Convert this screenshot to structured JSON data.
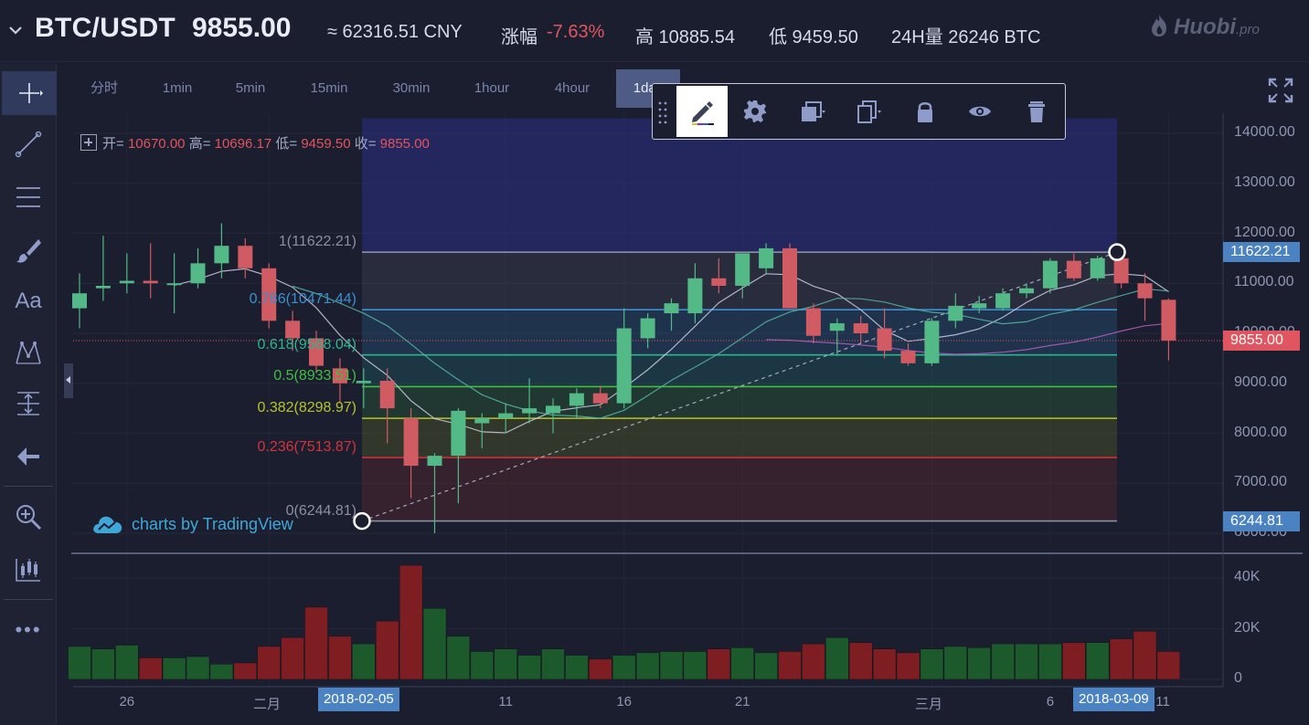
{
  "header": {
    "pair": "BTC/USDT",
    "price": "9855.00",
    "cny": "≈ 62316.51 CNY",
    "change_label": "涨幅",
    "change_value": "-7.63%",
    "high": "高 10885.54",
    "low": "低 9459.50",
    "volume24h": "24H量 26246 BTC",
    "logo": "Huobi",
    "logo_suffix": ".pro"
  },
  "left_toolbar": {
    "items": [
      "crosshair-icon",
      "trend-line-icon",
      "horizontal-lines-icon",
      "brush-icon",
      "text-icon",
      "pattern-icon",
      "measure-icon",
      "back-arrow-icon",
      "zoom-in-icon",
      "bar-chart-icon",
      "more-icon"
    ],
    "text_tool_label": "Aa",
    "more_label": "•••"
  },
  "intervals": [
    {
      "label": "分时"
    },
    {
      "label": "1min"
    },
    {
      "label": "5min"
    },
    {
      "label": "15min"
    },
    {
      "label": "30min"
    },
    {
      "label": "1hour"
    },
    {
      "label": "4hour"
    },
    {
      "label": "1day"
    }
  ],
  "active_interval": "1day",
  "floating_toolbar": [
    "pencil-icon",
    "gear-icon",
    "layer-icon",
    "copy-icon",
    "lock-icon",
    "eye-icon",
    "trash-icon"
  ],
  "legend": {
    "open_label": "开=",
    "open": "10670.00",
    "high_label": "高=",
    "high": "10696.17",
    "low_label": "低=",
    "low": "9459.50",
    "close_label": "收=",
    "close": "9855.00"
  },
  "watermark": "charts by TradingView",
  "fib_levels": [
    {
      "label": "1(11622.21)",
      "price": 11622.21,
      "color": "#8a8fa3"
    },
    {
      "label": "0.786(10471.44)",
      "price": 10471.44,
      "color": "#3a8fd0"
    },
    {
      "label": "0.618(9568.04)",
      "price": 9568.04,
      "color": "#2bb58f"
    },
    {
      "label": "0.5(8933.51)",
      "price": 8933.51,
      "color": "#3fbf3f"
    },
    {
      "label": "0.382(8298.97)",
      "price": 8298.97,
      "color": "#b5c42a"
    },
    {
      "label": "0.236(7513.87)",
      "price": 7513.87,
      "color": "#d1343c"
    },
    {
      "label": "0(6244.81)",
      "price": 6244.81,
      "color": "#8a8fa3"
    }
  ],
  "y_axis": {
    "ticks": [
      "14000.00",
      "13000.00",
      "12000.00",
      "11000.00",
      "10000.00",
      "9000.00",
      "8000.00",
      "7000.00",
      "6000.00"
    ],
    "badges": [
      {
        "label": "11622.21",
        "price": 11622.21,
        "color": "#4b82c2"
      },
      {
        "label": "9855.00",
        "price": 9855.0,
        "color": "#e0555f"
      },
      {
        "label": "6244.81",
        "price": 6244.81,
        "color": "#4b82c2"
      }
    ],
    "volume_ticks": [
      "40K",
      "20K",
      "0"
    ]
  },
  "x_axis": {
    "ticks": [
      "26",
      "二月",
      "11",
      "16",
      "21",
      "三月",
      "6",
      "11"
    ],
    "badges": [
      "2018-02-05",
      "2018-03-09"
    ]
  },
  "chart_data": {
    "type": "candlestick",
    "symbol": "BTC/USDT",
    "interval": "1day",
    "ylim": [
      5700,
      14300
    ],
    "volume_ylim": [
      0,
      45000
    ],
    "current_price": 9855.0,
    "series": [
      {
        "open": 10500,
        "high": 11200,
        "low": 10100,
        "close": 10800,
        "volume": 13000
      },
      {
        "open": 10900,
        "high": 11950,
        "low": 10650,
        "close": 10950,
        "volume": 12000
      },
      {
        "open": 11000,
        "high": 11600,
        "low": 10800,
        "close": 11050,
        "volume": 13500
      },
      {
        "open": 11050,
        "high": 11800,
        "low": 10700,
        "close": 11000,
        "volume": 8500
      },
      {
        "open": 11000,
        "high": 11600,
        "low": 10400,
        "close": 11000,
        "volume": 8500
      },
      {
        "open": 11000,
        "high": 11700,
        "low": 10900,
        "close": 11400,
        "volume": 9000
      },
      {
        "open": 11400,
        "high": 12200,
        "low": 11100,
        "close": 11750,
        "volume": 6000
      },
      {
        "open": 11750,
        "high": 11900,
        "low": 11100,
        "close": 11300,
        "volume": 6500
      },
      {
        "open": 11300,
        "high": 11400,
        "low": 10100,
        "close": 10250,
        "volume": 13000
      },
      {
        "open": 10250,
        "high": 10450,
        "low": 9650,
        "close": 9900,
        "volume": 16500
      },
      {
        "open": 9900,
        "high": 10050,
        "low": 9200,
        "close": 9350,
        "volume": 28500
      },
      {
        "open": 9300,
        "high": 9500,
        "low": 8600,
        "close": 9000,
        "volume": 17000
      },
      {
        "open": 9000,
        "high": 9300,
        "low": 8500,
        "close": 9050,
        "volume": 14000
      },
      {
        "open": 9050,
        "high": 9300,
        "low": 7800,
        "close": 8500,
        "volume": 23000
      },
      {
        "open": 8300,
        "high": 8500,
        "low": 6700,
        "close": 7350,
        "volume": 45000
      },
      {
        "open": 7350,
        "high": 7600,
        "low": 6000,
        "close": 7550,
        "volume": 28000
      },
      {
        "open": 7550,
        "high": 8500,
        "low": 6600,
        "close": 8450,
        "volume": 17000
      },
      {
        "open": 8200,
        "high": 8400,
        "low": 7700,
        "close": 8300,
        "volume": 11000
      },
      {
        "open": 8300,
        "high": 8600,
        "low": 8000,
        "close": 8400,
        "volume": 12000
      },
      {
        "open": 8400,
        "high": 9100,
        "low": 8200,
        "close": 8500,
        "volume": 9500
      },
      {
        "open": 8400,
        "high": 8700,
        "low": 8000,
        "close": 8550,
        "volume": 12000
      },
      {
        "open": 8550,
        "high": 8900,
        "low": 8300,
        "close": 8800,
        "volume": 9500
      },
      {
        "open": 8800,
        "high": 8950,
        "low": 8500,
        "close": 8600,
        "volume": 8000
      },
      {
        "open": 8600,
        "high": 10500,
        "low": 8500,
        "close": 10100,
        "volume": 9500
      },
      {
        "open": 9900,
        "high": 10400,
        "low": 9700,
        "close": 10300,
        "volume": 10500
      },
      {
        "open": 10400,
        "high": 10700,
        "low": 10050,
        "close": 10600,
        "volume": 11000
      },
      {
        "open": 10400,
        "high": 11400,
        "low": 10200,
        "close": 11100,
        "volume": 11000
      },
      {
        "open": 11100,
        "high": 11500,
        "low": 10800,
        "close": 10950,
        "volume": 12000
      },
      {
        "open": 10950,
        "high": 11500,
        "low": 10700,
        "close": 11600,
        "volume": 12500
      },
      {
        "open": 11300,
        "high": 11800,
        "low": 11200,
        "close": 11700,
        "volume": 10500
      },
      {
        "open": 11700,
        "high": 11800,
        "low": 10500,
        "close": 10500,
        "volume": 11000
      },
      {
        "open": 10500,
        "high": 10600,
        "low": 9800,
        "close": 9950,
        "volume": 14000
      },
      {
        "open": 10050,
        "high": 10300,
        "low": 9550,
        "close": 10200,
        "volume": 16500
      },
      {
        "open": 10200,
        "high": 10350,
        "low": 9800,
        "close": 10000,
        "volume": 14500
      },
      {
        "open": 10100,
        "high": 10500,
        "low": 9500,
        "close": 9650,
        "volume": 12000
      },
      {
        "open": 9650,
        "high": 9800,
        "low": 9350,
        "close": 9400,
        "volume": 10500
      },
      {
        "open": 9400,
        "high": 10300,
        "low": 9350,
        "close": 10250,
        "volume": 12000
      },
      {
        "open": 10250,
        "high": 10800,
        "low": 10100,
        "close": 10550,
        "volume": 13000
      },
      {
        "open": 10500,
        "high": 10750,
        "low": 10400,
        "close": 10600,
        "volume": 12500
      },
      {
        "open": 10500,
        "high": 10900,
        "low": 10450,
        "close": 10800,
        "volume": 14000
      },
      {
        "open": 10800,
        "high": 11000,
        "low": 10700,
        "close": 10900,
        "volume": 14000
      },
      {
        "open": 10900,
        "high": 11500,
        "low": 10800,
        "close": 11450,
        "volume": 14000
      },
      {
        "open": 11450,
        "high": 11600,
        "low": 11050,
        "close": 11100,
        "volume": 14500
      },
      {
        "open": 11100,
        "high": 11550,
        "low": 11050,
        "close": 11500,
        "volume": 14500
      },
      {
        "open": 11500,
        "high": 11700,
        "low": 10900,
        "close": 11000,
        "volume": 16000
      },
      {
        "open": 11000,
        "high": 11200,
        "low": 10250,
        "close": 10700,
        "volume": 19000
      },
      {
        "open": 10670,
        "high": 10696,
        "low": 9459.5,
        "close": 9855,
        "volume": 11000
      }
    ]
  }
}
